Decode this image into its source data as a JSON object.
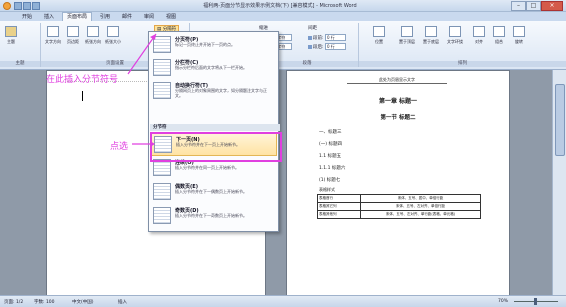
{
  "window": {
    "title": "福利两-页面分节显示效果示例文档(下) [兼容模式] - Microsoft Word"
  },
  "tabs": [
    "开始",
    "插入",
    "页面布局",
    "引用",
    "邮件",
    "审阅",
    "视图"
  ],
  "ribbon": {
    "groups": {
      "theme": "主题",
      "page_setup": "页面设置",
      "paragraph": "段落",
      "arrange": "排列"
    },
    "buttons": {
      "theme": "主题",
      "text_direction": "文字方向",
      "margins": "页边距",
      "orientation": "纸张方向",
      "size": "纸张大小",
      "breaks": "分隔符",
      "position": "位置",
      "bring_front": "置于顶层",
      "send_back": "置于底层",
      "wrap": "文字环绕",
      "align": "对齐",
      "group": "组合",
      "rotate": "旋转"
    },
    "indent": {
      "label": "缩进",
      "left_label": "左:",
      "left_value": "0 字符",
      "right_label": "右:",
      "right_value": "0 字符"
    },
    "spacing": {
      "label": "间距",
      "before_label": "段前:",
      "before_value": "0 行",
      "after_label": "段后:",
      "after_value": "0 行"
    }
  },
  "menu": {
    "section_breaks_header": "分节符",
    "items": [
      {
        "title": "分页符(P)",
        "desc": "标记一页终止并开始下一页的点。"
      },
      {
        "title": "分栏符(C)",
        "desc": "指示分栏符后面的文字将从下一栏开始。"
      },
      {
        "title": "自动换行符(T)",
        "desc": "分隔网页上的对象周围的文字，如分隔题注文字与正文。"
      },
      {
        "title": "下一页(N)",
        "desc": "插入分节符并在下一页上开始新节。"
      },
      {
        "title": "连续(O)",
        "desc": "插入分节符并在同一页上开始新节。"
      },
      {
        "title": "偶数页(E)",
        "desc": "插入分节符并在下一偶数页上开始新节。"
      },
      {
        "title": "奇数页(D)",
        "desc": "插入分节符并在下一奇数页上开始新节。"
      }
    ]
  },
  "annotations": {
    "insert_here": "在此插入分节符号",
    "click_here": "点选"
  },
  "document": {
    "page2": {
      "header_text": "此处为页眉显示文字",
      "chapter": "第一章   标题一",
      "section": "第一节   标题二",
      "lines": [
        "一、标题三",
        "(一) 标题四",
        "1.1 标题五",
        "1.1.1 标题六",
        "(1) 标题七"
      ],
      "table_caption": "表格样式",
      "table": [
        [
          "表格首行",
          "宋体、五号、居中、单倍行距"
        ],
        [
          "表格其它列",
          "宋体、五号、左对齐、单倍行距"
        ],
        [
          "表格其他列",
          "宋体、五号、左对齐、单行距(表格、单元格)"
        ]
      ]
    }
  },
  "status": {
    "page": "页面: 1/2",
    "words": "字数: 100",
    "lang": "中文(中国)",
    "mode": "插入",
    "zoom": "70%"
  }
}
